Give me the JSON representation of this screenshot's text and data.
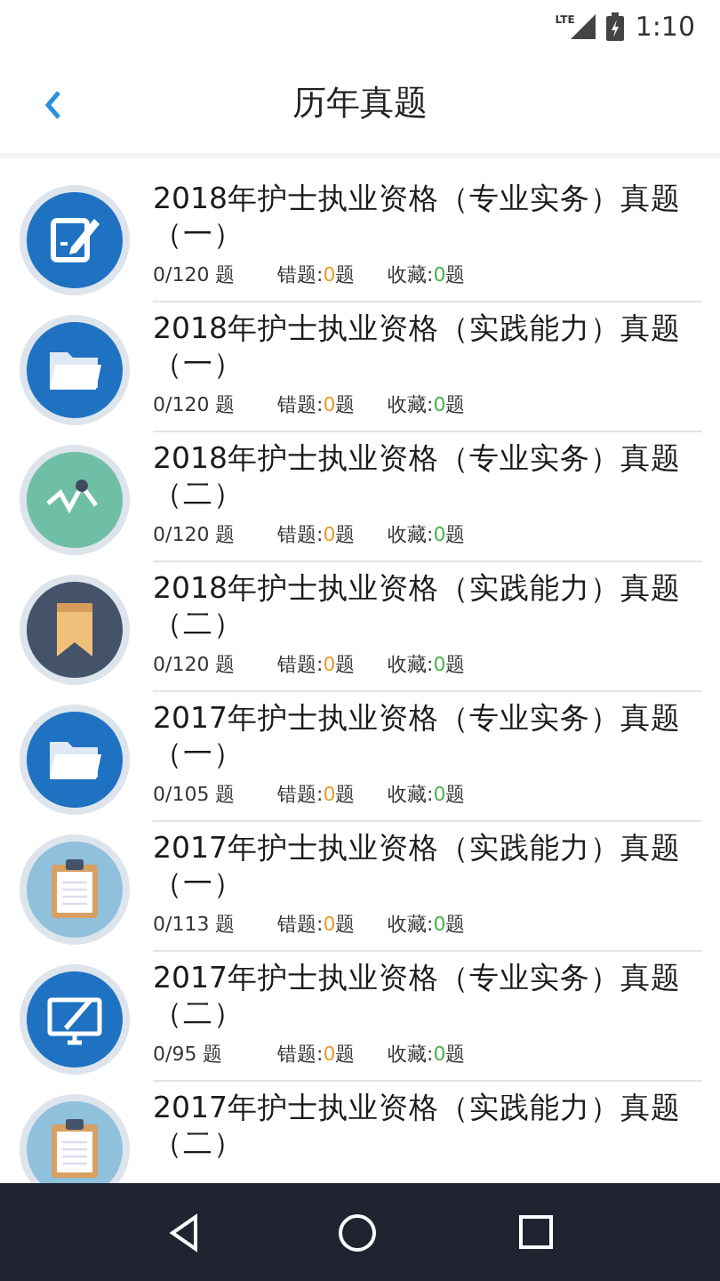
{
  "status_bar": {
    "network": "LTE",
    "time": "1:10"
  },
  "header": {
    "title": "历年真题"
  },
  "items": [
    {
      "title": "2018年护士执业资格（专业实务）真题（一）",
      "progress": "0/120 题",
      "wrong": {
        "label": "错题:",
        "count": "0",
        "unit": "题"
      },
      "favorites": {
        "label": "收藏:",
        "count": "0",
        "unit": "题"
      }
    },
    {
      "title": "2018年护士执业资格（实践能力）真题（一）",
      "progress": "0/120 题",
      "wrong": {
        "label": "错题:",
        "count": "0",
        "unit": "题"
      },
      "favorites": {
        "label": "收藏:",
        "count": "0",
        "unit": "题"
      }
    },
    {
      "title": "2018年护士执业资格（专业实务）真题（二）",
      "progress": "0/120 题",
      "wrong": {
        "label": "错题:",
        "count": "0",
        "unit": "题"
      },
      "favorites": {
        "label": "收藏:",
        "count": "0",
        "unit": "题"
      }
    },
    {
      "title": "2018年护士执业资格（实践能力）真题（二）",
      "progress": "0/120 题",
      "wrong": {
        "label": "错题:",
        "count": "0",
        "unit": "题"
      },
      "favorites": {
        "label": "收藏:",
        "count": "0",
        "unit": "题"
      }
    },
    {
      "title": "2017年护士执业资格（专业实务）真题（一）",
      "progress": "0/105 题",
      "wrong": {
        "label": "错题:",
        "count": "0",
        "unit": "题"
      },
      "favorites": {
        "label": "收藏:",
        "count": "0",
        "unit": "题"
      }
    },
    {
      "title": "2017年护士执业资格（实践能力）真题（一）",
      "progress": "0/113 题",
      "wrong": {
        "label": "错题:",
        "count": "0",
        "unit": "题"
      },
      "favorites": {
        "label": "收藏:",
        "count": "0",
        "unit": "题"
      }
    },
    {
      "title": "2017年护士执业资格（专业实务）真题（二）",
      "progress": "0/95 题",
      "wrong": {
        "label": "错题:",
        "count": "0",
        "unit": "题"
      },
      "favorites": {
        "label": "收藏:",
        "count": "0",
        "unit": "题"
      }
    },
    {
      "title": "2017年护士执业资格（实践能力）真题（二）"
    }
  ]
}
